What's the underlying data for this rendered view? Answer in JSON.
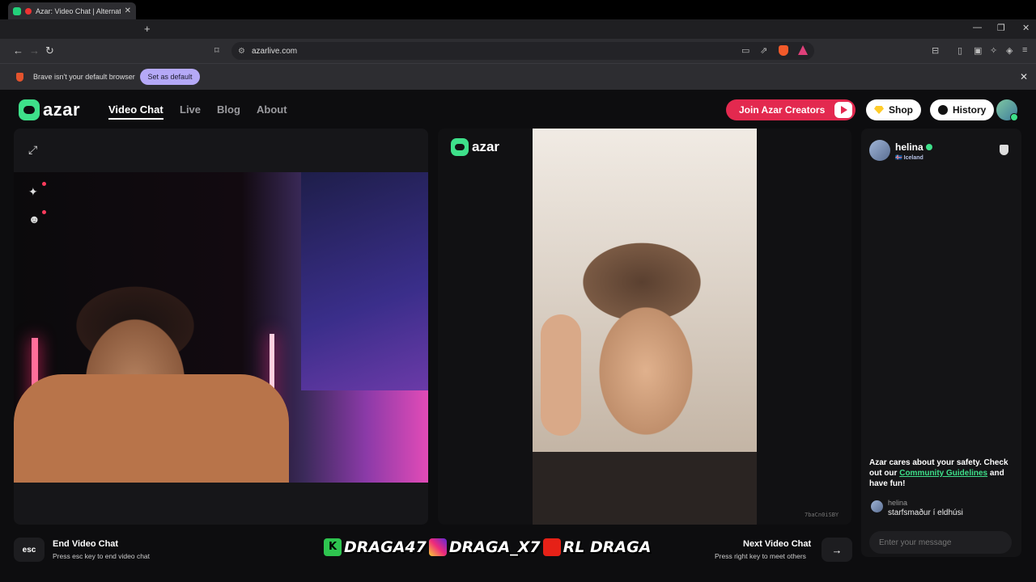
{
  "browser": {
    "tab_title": "Azar: Video Chat | Alternative",
    "tab_close": "✕",
    "new_tab": "+",
    "url": "azarlive.com",
    "infobar_message": "Brave isn't your default browser",
    "set_default_label": "Set as default",
    "infobar_close": "✕",
    "window_minimize": "—",
    "window_restore": "❐",
    "window_close": "✕",
    "nav_back": "←",
    "nav_forward": "→",
    "nav_reload": "↻"
  },
  "site": {
    "logo_text": "azar",
    "nav": [
      {
        "label": "Video Chat",
        "active": true
      },
      {
        "label": "Live"
      },
      {
        "label": "Blog"
      },
      {
        "label": "About"
      }
    ],
    "creators_label": "Join Azar Creators",
    "shop_label": "Shop",
    "history_label": "History",
    "colors": {
      "brand_green": "#3ee08a",
      "creators_red": "#e3294f"
    }
  },
  "video": {
    "mid_logo_text": "azar",
    "session_id": "7baCn0iSBY"
  },
  "chat": {
    "peer_name": "helina",
    "peer_country": "🇮🇸 Iceland",
    "safety_text_1": "Azar cares about your safety. Check out our ",
    "safety_link": "Community Guidelines",
    "safety_text_2": " and have fun!",
    "messages": [
      {
        "name": "helina",
        "text": "starfsmaður í eldhúsi"
      }
    ],
    "input_placeholder": "Enter your message"
  },
  "controls": {
    "esc_key": "esc",
    "end_title": "End Video Chat",
    "end_sub": "Press esc key to end video chat",
    "next_title": "Next Video Chat",
    "next_sub": "Press right key to meet others",
    "next_arrow": "→"
  },
  "overlay": {
    "k_icon": "K",
    "k_handle": "DRAGA47",
    "ig_handle": "DRAGA_X7",
    "yt_handle": "RL DRAGA"
  }
}
